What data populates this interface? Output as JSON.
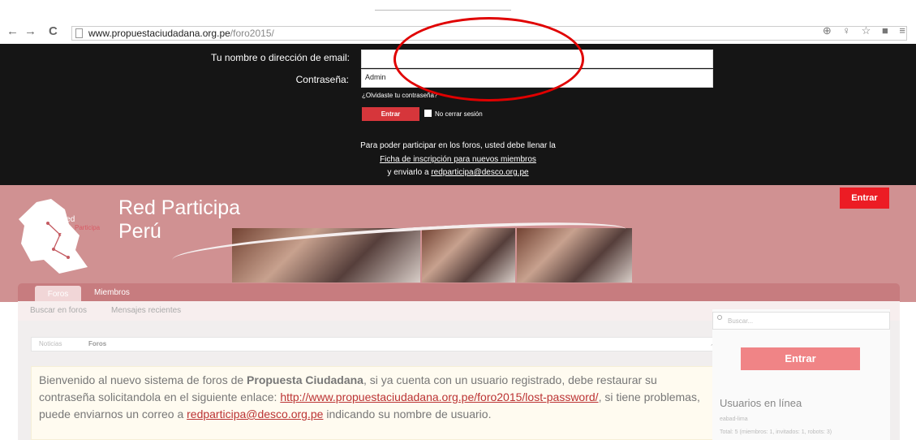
{
  "browser": {
    "url_host": "www.propuestaciudadana.org.pe",
    "url_path": "/foro2015/",
    "back": "←",
    "forward": "→",
    "reload": "C",
    "right_icons": "⊕ ♀ ☆ ■ ≡"
  },
  "login": {
    "email_label": "Tu nombre o dirección de email:",
    "password_label": "Contraseña:",
    "password_value": "Admin",
    "forgot": "¿Olvidaste tu contraseña?",
    "submit": "Entrar",
    "remember": "No cerrar sesión",
    "notice_1": "Para poder participar en los foros, usted debe llenar la",
    "notice_link": "Ficha de inscripción para nuevos miembros",
    "notice_2": "y enviarlo a ",
    "notice_email": "redparticipa@desco.org.pe"
  },
  "header": {
    "title_1": "Red Participa",
    "title_2": "Perú",
    "logo_1": "Red",
    "logo_2": "Participa",
    "logo_3": "Perú",
    "login_button": "Entrar",
    "tabs": [
      {
        "label": "Foros"
      },
      {
        "label": "Miembros"
      }
    ]
  },
  "subnav": {
    "items": [
      {
        "label": "Buscar en foros"
      },
      {
        "label": "Mensajes recientes"
      }
    ]
  },
  "breadcrumb": {
    "items": [
      {
        "label": "Noticias"
      },
      {
        "label": "Foros"
      }
    ]
  },
  "welcome": {
    "part_1": "Bienvenido al nuevo sistema de foros de ",
    "brand": "Propuesta Ciudadana",
    "part_2": ", si ya cuenta con un usuario registrado, debe restaurar su contraseña solicitandola en el siguiente enlace: ",
    "link": "http://www.propuestaciudadana.org.pe/foro2015/lost-password/",
    "part_3": ", si tiene problemas, puede enviarnos un correo a ",
    "email": "redparticipa@desco.org.pe",
    "part_4": " indicando su nombre de usuario."
  },
  "sidebar": {
    "search_placeholder": "Buscar...",
    "login_button": "Entrar",
    "online_title": "Usuarios en línea",
    "online_user": "eabad-lima",
    "online_total": "Total: 5 (miembros: 1, invitados: 1, robots: 3)"
  },
  "colors": {
    "dark_panel": "#151515",
    "header_pink": "#d09192",
    "accent_red": "#ec1c24",
    "annotation": "#e00000"
  }
}
